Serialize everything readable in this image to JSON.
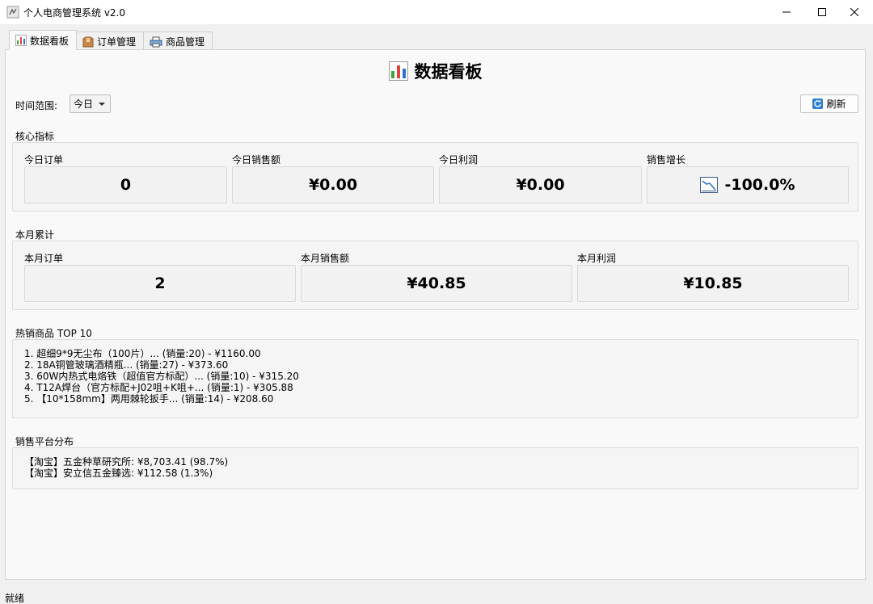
{
  "window": {
    "title": "个人电商管理系统 v2.0"
  },
  "tabs": [
    {
      "label": "数据看板",
      "icon": "bar-chart-icon",
      "active": true
    },
    {
      "label": "订单管理",
      "icon": "box-icon",
      "active": false
    },
    {
      "label": "商品管理",
      "icon": "printer-icon",
      "active": false
    }
  ],
  "dashboard": {
    "title": "数据看板",
    "time_range_label": "时间范围:",
    "time_range_value": "今日",
    "refresh_label": "刷新",
    "core": {
      "section_label": "核心指标",
      "cards": [
        {
          "label": "今日订单",
          "value": "0"
        },
        {
          "label": "今日销售额",
          "value": "¥0.00"
        },
        {
          "label": "今日利润",
          "value": "¥0.00"
        },
        {
          "label": "销售增长",
          "value": "-100.0%",
          "icon": "chart-decreasing-icon"
        }
      ]
    },
    "month": {
      "section_label": "本月累计",
      "cards": [
        {
          "label": "本月订单",
          "value": "2"
        },
        {
          "label": "本月销售额",
          "value": "¥40.85"
        },
        {
          "label": "本月利润",
          "value": "¥10.85"
        }
      ]
    },
    "top_products": {
      "section_label": "热销商品 TOP 10",
      "lines": [
        "1. 超细9*9无尘布（100片）... (销量:20) - ¥1160.00",
        "2. 18A铜管玻璃酒精瓶... (销量:27) - ¥373.60",
        "3. 60W内热式电烙铁（超值官方标配）... (销量:10) - ¥315.20",
        "4. T12A焊台（官方标配+J02咀+K咀+... (销量:1) - ¥305.88",
        "5. 【10*158mm】两用棘轮扳手... (销量:14) - ¥208.60"
      ]
    },
    "platforms": {
      "section_label": "销售平台分布",
      "lines": [
        "【淘宝】五金种草研究所: ¥8,703.41 (98.7%)",
        "【淘宝】安立信五金臻选: ¥112.58 (1.3%)"
      ]
    }
  },
  "status": {
    "text": "就绪"
  },
  "colors": {
    "accent_blue": "#2f80d1",
    "chart_green": "#3aa63a",
    "chart_red": "#e04040",
    "chart_blue": "#2f6fd1"
  }
}
